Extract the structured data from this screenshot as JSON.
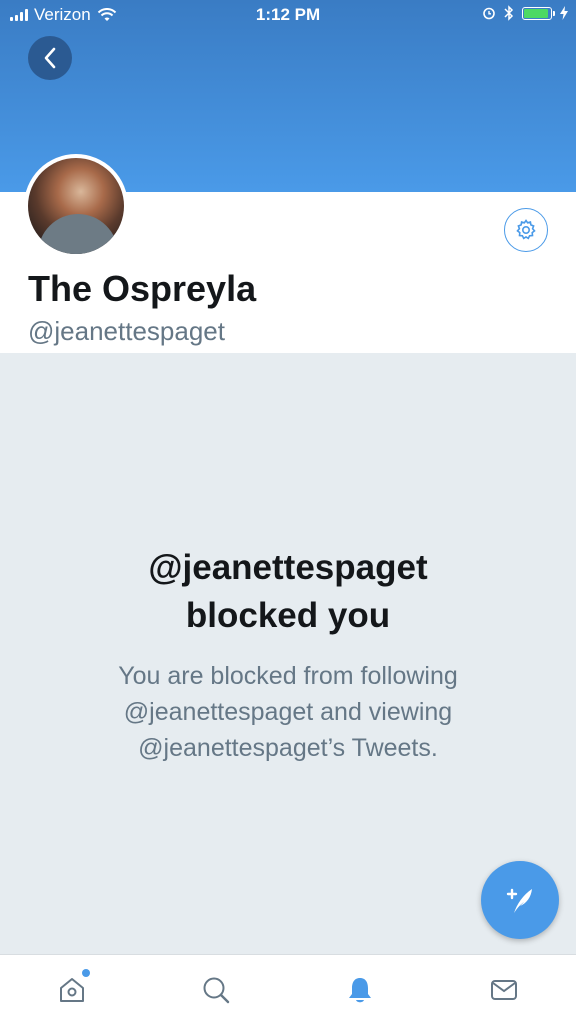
{
  "status_bar": {
    "carrier": "Verizon",
    "time": "1:12 PM"
  },
  "profile": {
    "display_name": "The Ospreyla",
    "screen_name": "@jeanettespaget"
  },
  "blocked": {
    "title_line1": "@jeanettespaget",
    "title_line2": "blocked you",
    "message_line1": "You are blocked from following",
    "message_line2": "@jeanettespaget and viewing",
    "message_line3": "@jeanettespaget’s Tweets."
  },
  "colors": {
    "accent": "#4a9ae8",
    "header_top": "#3a7cc4",
    "background": "#e6ecf0",
    "secondary_text": "#657786"
  },
  "icons": {
    "back": "chevron-left-icon",
    "settings": "gear-icon",
    "compose": "compose-tweet-icon",
    "tabs": [
      "home-icon",
      "search-icon",
      "notifications-icon",
      "messages-icon"
    ]
  },
  "tab_bar": {
    "active": "notifications",
    "home_has_badge": true
  }
}
